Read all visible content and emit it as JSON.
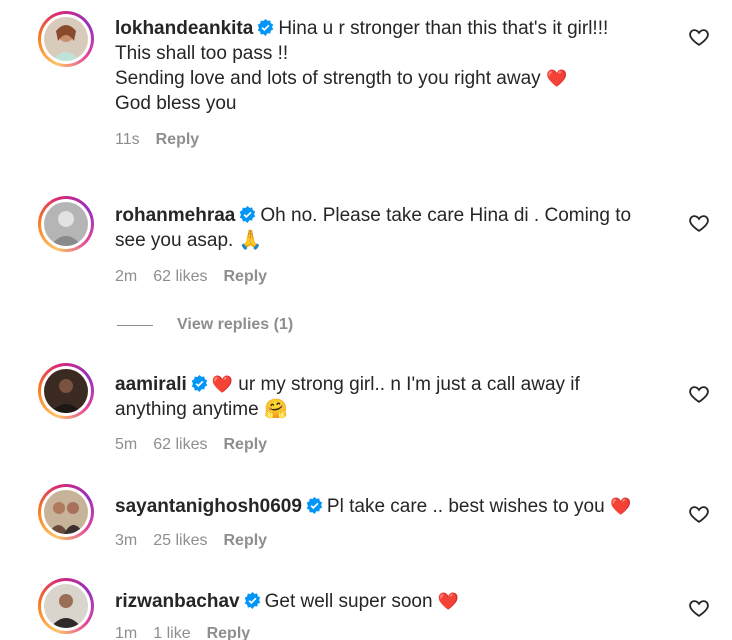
{
  "comments": [
    {
      "username": "lokhandeankita",
      "lines": [
        "Hina u r stronger than this that's it girl!!!",
        "This shall too pass !!",
        "Sending love and lots of strength to you right away",
        "God bless you"
      ],
      "emoji": "❤️",
      "time": "11s",
      "likes": "",
      "reply": "Reply"
    },
    {
      "username": "rohanmehraa",
      "lines": [
        "Oh no. Please take care Hina di . Coming to",
        "see you asap."
      ],
      "emoji": "🙏",
      "time": "2m",
      "likes": "62 likes",
      "reply": "Reply",
      "view_replies": "View replies (1)"
    },
    {
      "username": "aamirali",
      "lead_emoji": "❤️",
      "lines": [
        "ur my strong girl.. n I'm just a call away if",
        "anything anytime"
      ],
      "emoji": "🤗",
      "time": "5m",
      "likes": "62 likes",
      "reply": "Reply"
    },
    {
      "username": "sayantanighosh0609",
      "lines": [
        "Pl take care .. best wishes to you"
      ],
      "emoji": "❤️",
      "time": "3m",
      "likes": "25 likes",
      "reply": "Reply"
    },
    {
      "username": "rizwanbachav",
      "lines": [
        "Get well super soon"
      ],
      "emoji": "❤️",
      "time": "1m",
      "likes": "1 like",
      "reply": "Reply"
    }
  ],
  "colors": {
    "verified": "#0095f6",
    "meta": "#8e8e8e",
    "text": "#262626",
    "heart": "#e0245e"
  },
  "icons": {
    "verified": "verified-badge-icon",
    "like": "heart-outline-icon"
  }
}
